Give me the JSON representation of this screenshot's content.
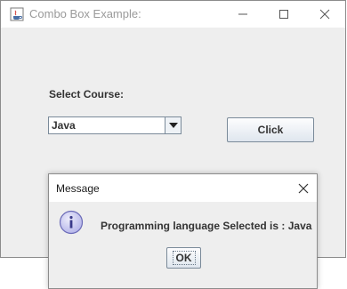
{
  "window": {
    "title": "Combo Box Example:",
    "controls": [
      "minimize-icon",
      "maximize-icon",
      "close-icon"
    ]
  },
  "form": {
    "course_label": "Select Course:",
    "combo_value": "Java",
    "click_label": "Click"
  },
  "dialog": {
    "title": "Message",
    "message": "Programming language Selected is : Java",
    "ok_label": "OK",
    "icon": "info-icon"
  },
  "colors": {
    "window_bg": "#eeeeee",
    "titlebar_bg": "#ffffff",
    "title_text": "#9a9a9a",
    "info_icon_fill": "#c9c9f2",
    "info_icon_border": "#6b6bb8"
  }
}
